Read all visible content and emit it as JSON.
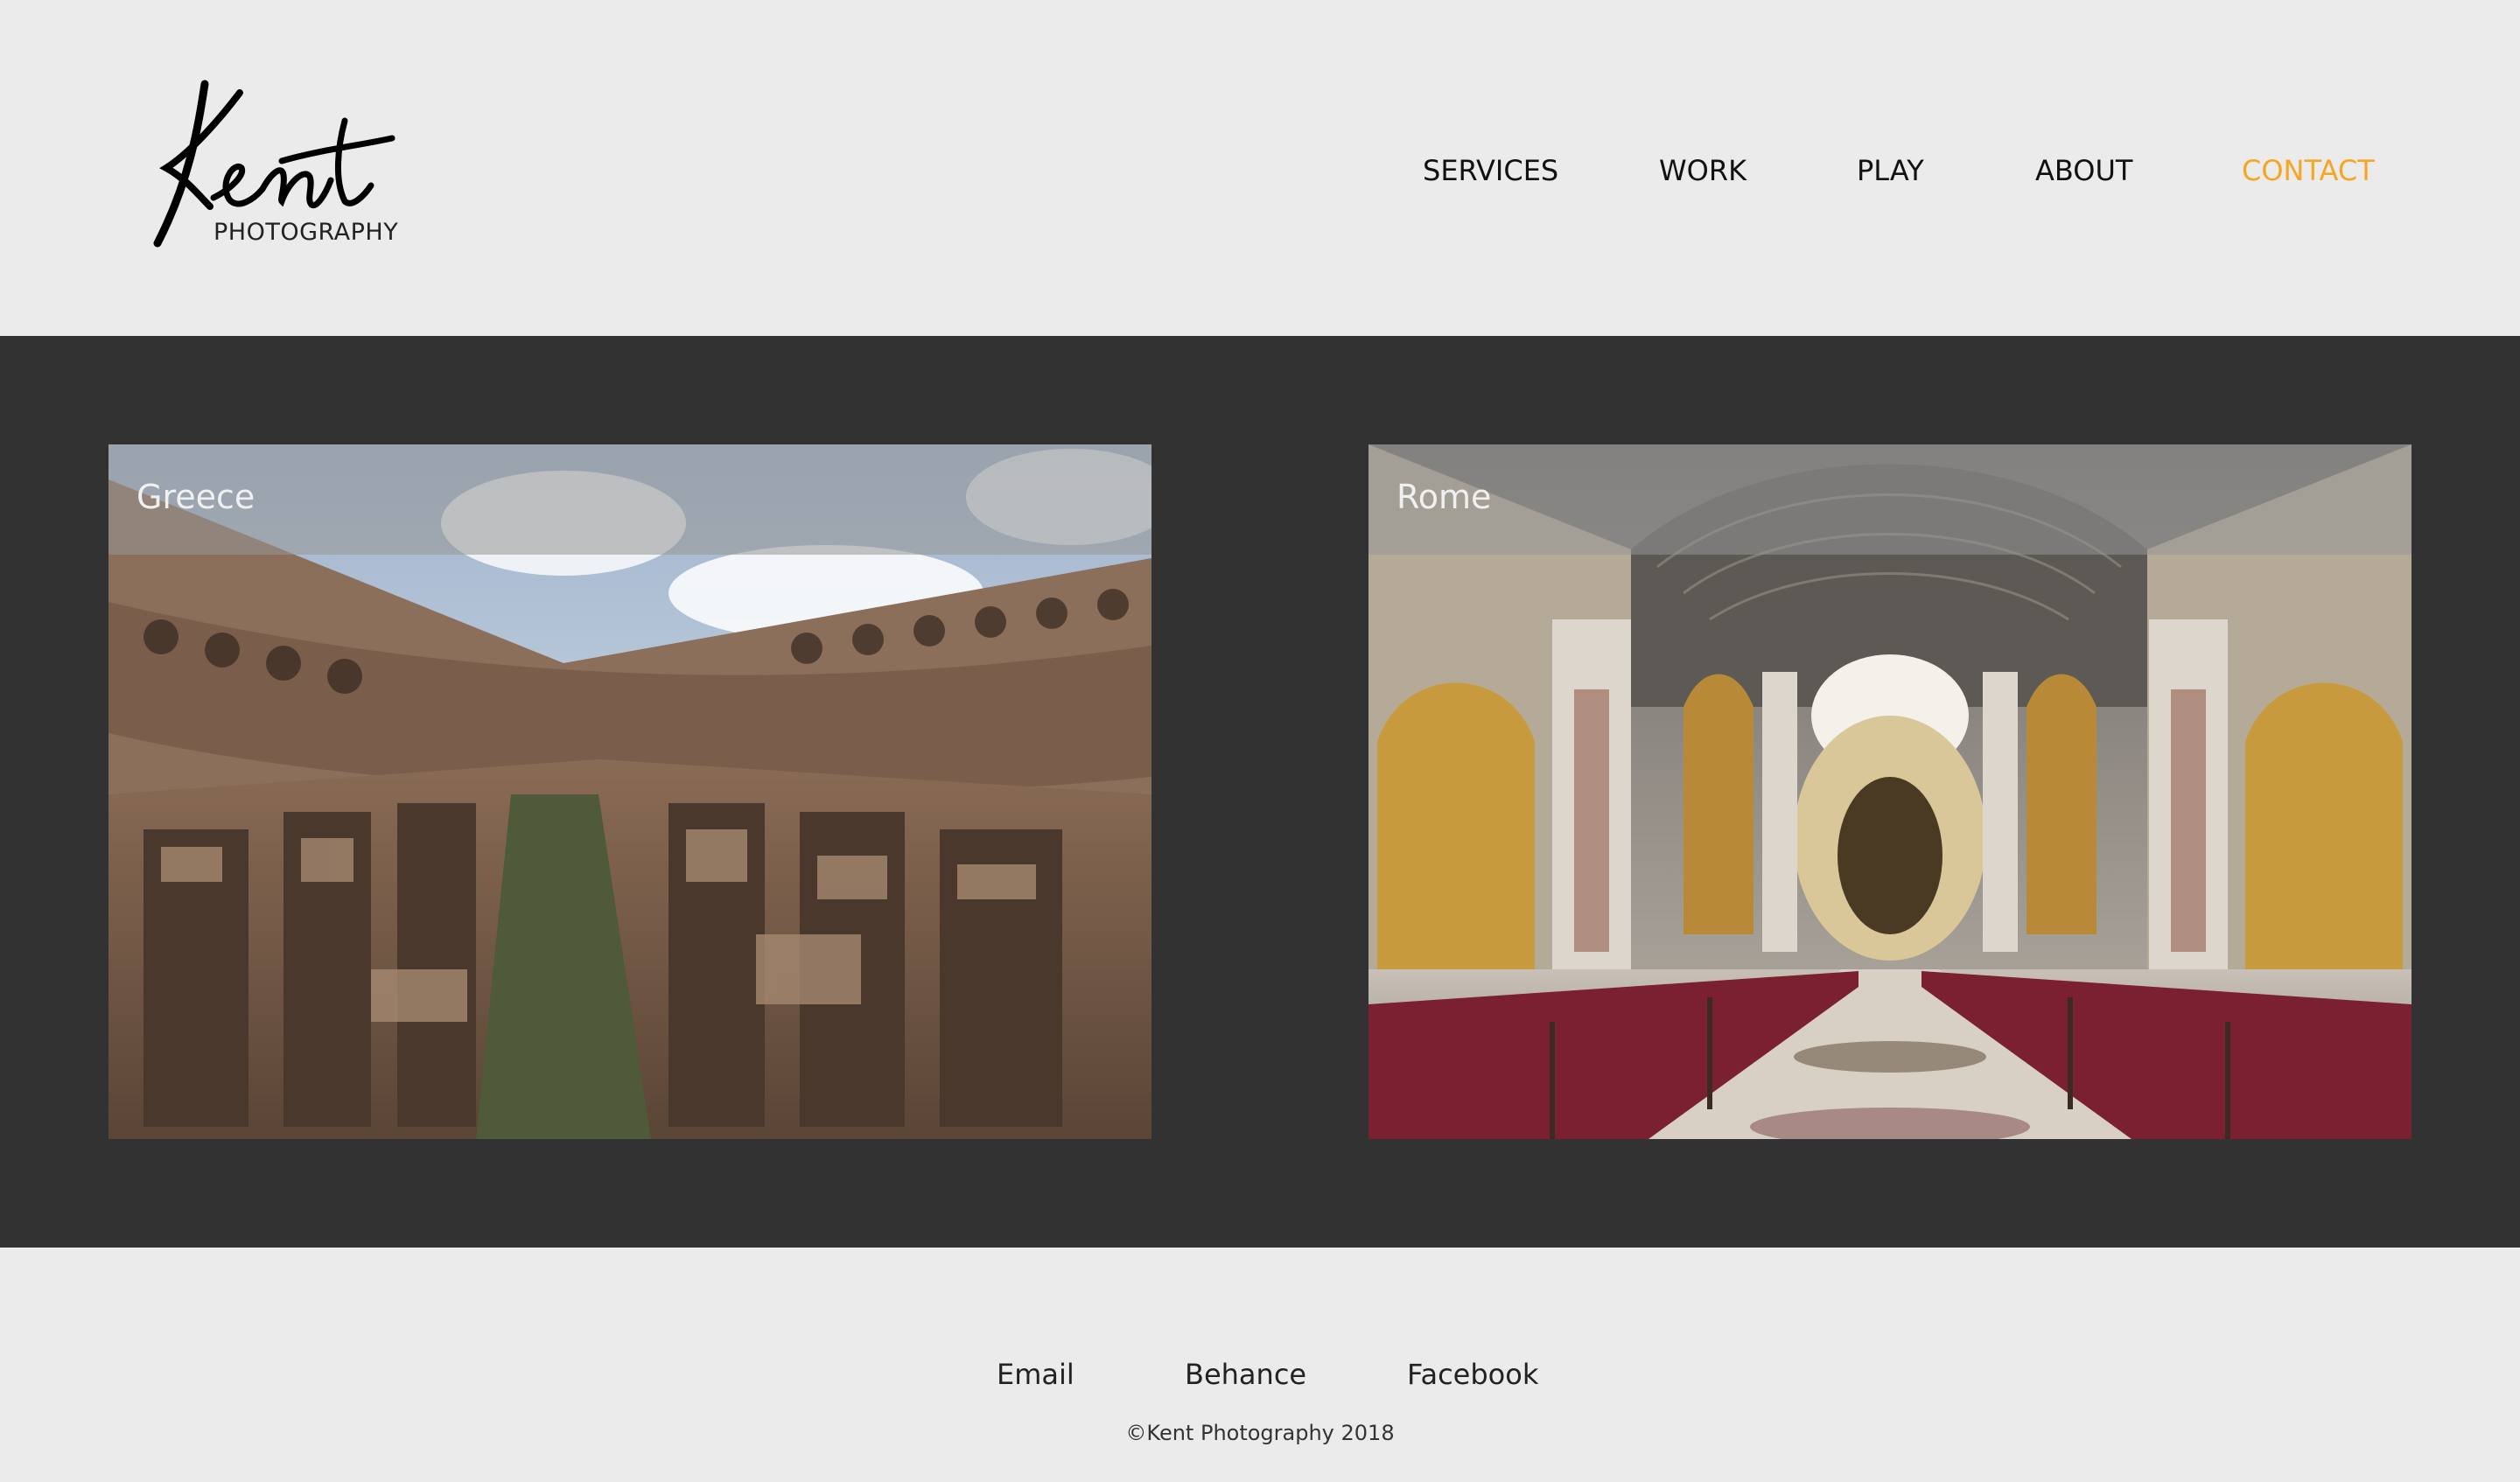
{
  "brand": {
    "logo_script": "Kent",
    "logo_subtitle": "PHOTOGRAPHY"
  },
  "nav": {
    "items": [
      {
        "label": "SERVICES",
        "active": false
      },
      {
        "label": "WORK",
        "active": false
      },
      {
        "label": "PLAY",
        "active": false
      },
      {
        "label": "ABOUT",
        "active": false
      },
      {
        "label": "CONTACT",
        "active": true
      }
    ]
  },
  "gallery": {
    "cards": [
      {
        "caption": "Greece",
        "image": "colosseum-interior-photo"
      },
      {
        "caption": "Rome",
        "image": "basilica-nave-photo"
      }
    ]
  },
  "footer": {
    "links": [
      {
        "label": "Email"
      },
      {
        "label": "Behance"
      },
      {
        "label": "Facebook"
      }
    ],
    "copyright": "©Kent Photography 2018"
  },
  "colors": {
    "page_bg": "#ebebeb",
    "band_bg": "#323232",
    "accent": "#f5a623",
    "text": "#111111"
  }
}
